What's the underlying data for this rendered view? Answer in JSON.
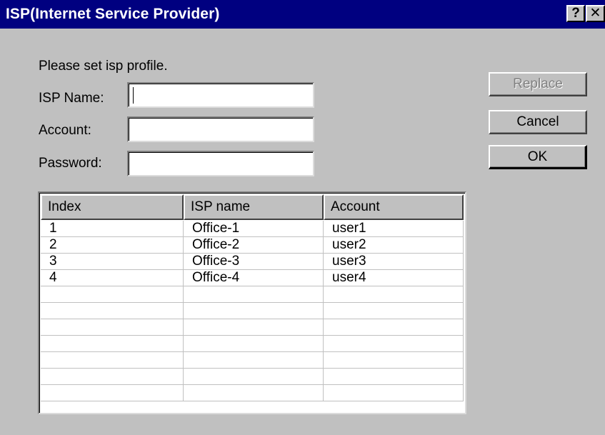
{
  "window": {
    "title": "ISP(Internet Service Provider)",
    "help_label": "?",
    "close_label": "✕"
  },
  "form": {
    "instruction": "Please set isp profile.",
    "isp_name_label": "ISP Name:",
    "account_label": "Account:",
    "password_label": "Password:",
    "isp_name_value": "",
    "account_value": "",
    "password_value": ""
  },
  "buttons": {
    "replace_label": "Replace",
    "cancel_label": "Cancel",
    "ok_label": "OK"
  },
  "table": {
    "columns": [
      "Index",
      "ISP name",
      "Account"
    ],
    "rows": [
      [
        "1",
        "Office-1",
        "user1"
      ],
      [
        "2",
        "Office-2",
        "user2"
      ],
      [
        "3",
        "Office-3",
        "user3"
      ],
      [
        "4",
        "Office-4",
        "user4"
      ],
      [
        "",
        "",
        ""
      ],
      [
        "",
        "",
        ""
      ],
      [
        "",
        "",
        ""
      ],
      [
        "",
        "",
        ""
      ],
      [
        "",
        "",
        ""
      ],
      [
        "",
        "",
        ""
      ],
      [
        "",
        "",
        ""
      ]
    ]
  }
}
